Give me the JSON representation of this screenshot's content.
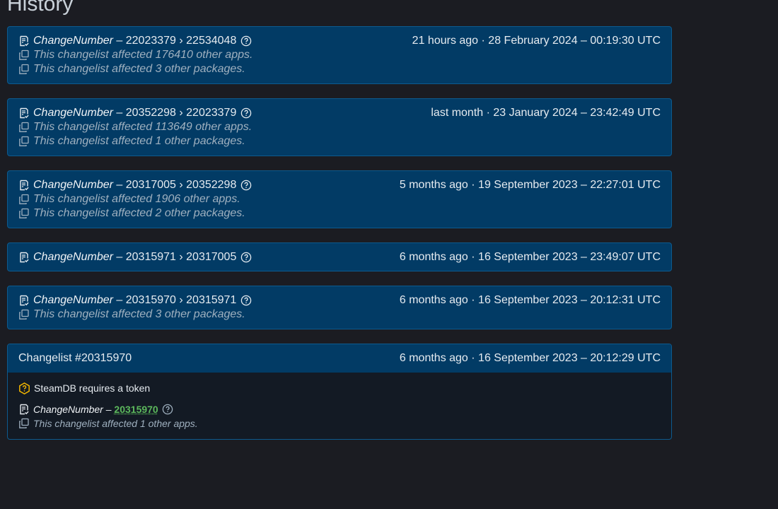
{
  "page": {
    "title": "History"
  },
  "entries": [
    {
      "key": "ChangeNumber",
      "change": " – 22023379 › 22534048",
      "time": "21 hours ago · 28 February 2024 – 00:19:30 UTC",
      "apps": "This changelist affected 176410 other apps.",
      "packages": "This changelist affected 3 other packages."
    },
    {
      "key": "ChangeNumber",
      "change": " – 20352298 › 22023379",
      "time": "last month · 23 January 2024 – 23:42:49 UTC",
      "apps": "This changelist affected 113649 other apps.",
      "packages": "This changelist affected 1 other packages."
    },
    {
      "key": "ChangeNumber",
      "change": " – 20317005 › 20352298",
      "time": "5 months ago · 19 September 2023 – 22:27:01 UTC",
      "apps": "This changelist affected 1906 other apps.",
      "packages": "This changelist affected 2 other packages."
    },
    {
      "key": "ChangeNumber",
      "change": " – 20315971 › 20317005",
      "time": "6 months ago · 16 September 2023 – 23:49:07 UTC"
    },
    {
      "key": "ChangeNumber",
      "change": " – 20315970 › 20315971",
      "time": "6 months ago · 16 September 2023 – 20:12:31 UTC",
      "packages": "This changelist affected 3 other packages."
    }
  ],
  "changelist": {
    "title": "Changelist #20315970",
    "time": "6 months ago · 16 September 2023 – 20:12:29 UTC",
    "token_notice": "SteamDB requires a token",
    "key": "ChangeNumber",
    "sep": " – ",
    "value": "20315970",
    "apps": "This changelist affected 1 other apps."
  },
  "colors": {
    "card_bg": "#023b65",
    "border": "#0d5a8e",
    "page_bg": "#1b1c22",
    "link": "#5cb85c",
    "warning": "#f0b400"
  },
  "icons": [
    "changelist-icon",
    "help-icon",
    "copy-icon",
    "warning-icon"
  ]
}
